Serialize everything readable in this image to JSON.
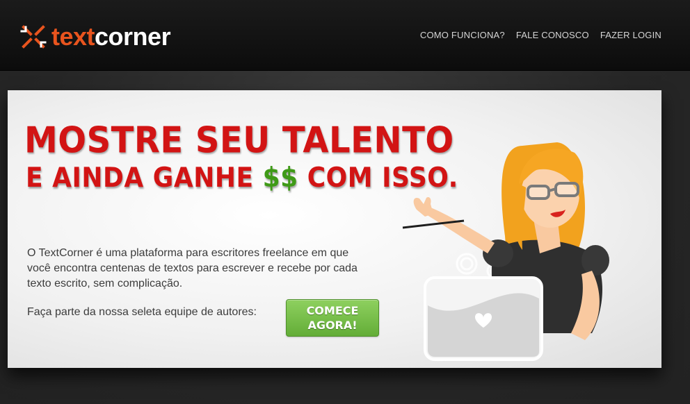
{
  "header": {
    "logo_text_part1": "text",
    "logo_text_part2": "corner",
    "nav": {
      "how_it_works": "COMO FUNCIONA?",
      "contact": "FALE CONOSCO",
      "login": "FAZER LOGIN"
    }
  },
  "hero": {
    "headline_line1": "MOSTRE SEU TALENTO",
    "headline_line2_before": "E AINDA GANHE ",
    "headline_line2_money": "$$",
    "headline_line2_after": " COM ISSO.",
    "description": "O TextCorner é uma plataforma para escritores freelance em que você encontra centenas de textos para escrever e recebe por cada texto escrito, sem complicação.",
    "cta_text": "Faça parte da nossa seleta equipe de autores:",
    "cta_button_line1": "COMECE",
    "cta_button_line2": "AGORA!"
  },
  "colors": {
    "brand_orange": "#e8541e",
    "headline_red": "#d21414",
    "money_green": "#3f9a17",
    "cta_green": "#6fb942"
  },
  "icons": {
    "logo_mark": "x-cross-arrows-icon",
    "laptop_logo": "heart-icon"
  }
}
